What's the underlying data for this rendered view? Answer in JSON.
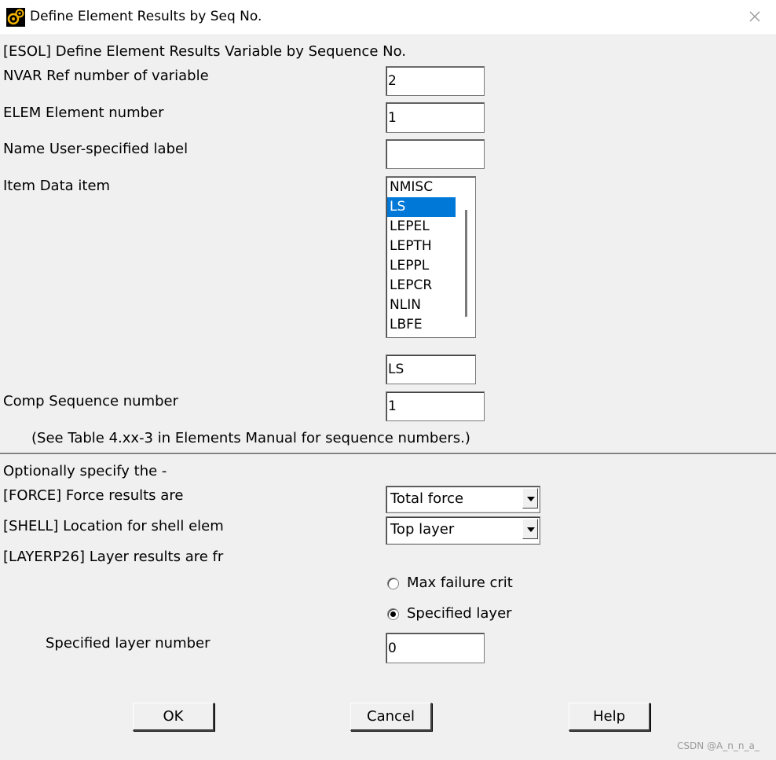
{
  "window": {
    "title": "Define Element Results by Seq No."
  },
  "header": {
    "text": "[ESOL]  Define  Element Results Variable by Sequence No."
  },
  "fields": {
    "nvar": {
      "label": "NVAR  Ref number of variable",
      "value": "2"
    },
    "elem": {
      "label": "ELEM  Element number",
      "value": "1"
    },
    "name": {
      "label": "Name  User-specified label",
      "value": ""
    },
    "item": {
      "label": "Item  Data item",
      "selected_value": "LS"
    },
    "comp": {
      "label": "Comp  Sequence number",
      "value": "1"
    }
  },
  "item_list": {
    "options": [
      "NMISC",
      "LS",
      "LEPEL",
      "LEPTH",
      "LEPPL",
      "LEPCR",
      "NLIN",
      "LBFE"
    ],
    "selected": "LS"
  },
  "note": "(See Table 4.xx-3 in Elements Manual for sequence numbers.)",
  "optional": {
    "heading": "Optionally specify the -",
    "force": {
      "label": "[FORCE]  Force results are",
      "value": "Total force"
    },
    "shell": {
      "label": "[SHELL]  Location for shell elem",
      "value": "Top layer"
    },
    "layerp26": {
      "label": "[LAYERP26]  Layer results are fr"
    },
    "radio_max": "Max failure crit",
    "radio_specified": "Specified layer",
    "radio_selected": "Specified layer",
    "layer_number": {
      "label": "Specified layer number",
      "value": "0"
    }
  },
  "buttons": {
    "ok": "OK",
    "cancel": "Cancel",
    "help": "Help"
  },
  "watermark": "CSDN @A_n_n_a_"
}
